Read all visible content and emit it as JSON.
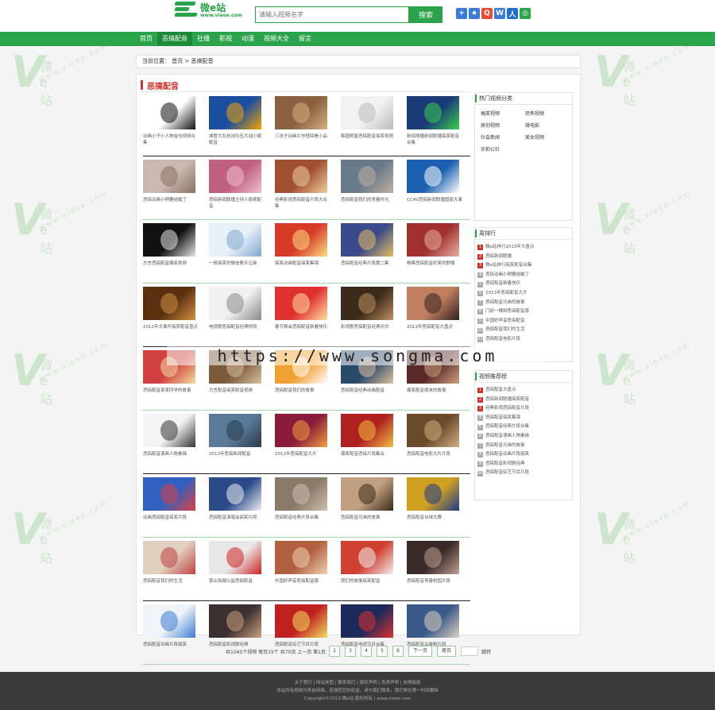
{
  "header": {
    "logo_name": "微e站",
    "logo_url": "www.vieee.com",
    "search_placeholder": "请输入视频名字",
    "search_button": "搜索",
    "share_icons": [
      {
        "name": "plus-icon",
        "glyph": "+",
        "color": "#3a7bd5"
      },
      {
        "name": "star-icon",
        "glyph": "★",
        "color": "#3a7bd5"
      },
      {
        "name": "qzone-icon",
        "glyph": "Q",
        "color": "#e94b35"
      },
      {
        "name": "weibo-icon",
        "glyph": "W",
        "color": "#3a7bd5"
      },
      {
        "name": "renren-icon",
        "glyph": "人",
        "color": "#1f6fc8"
      },
      {
        "name": "wechat-icon",
        "glyph": "◎",
        "color": "#2aa34a"
      }
    ]
  },
  "nav": [
    "首页",
    "恶搞配音",
    "社播",
    "影视",
    "动漫",
    "视频大全",
    "留言"
  ],
  "nav_active": 1,
  "breadcrumb": "当前位置：  首页  >  恶搞配音",
  "section_title": "恶搞配音",
  "videos": [
    {
      "caption": "动画小子小人物金句视频合集",
      "color": "#ffffff",
      "accent": "#111111"
    },
    {
      "caption": "城管大队执法队伍大战小贩配音",
      "color": "#1a4fa0",
      "accent": "#f2a400"
    },
    {
      "caption": "三孩子动画片作怪回看小品",
      "color": "#8a6040",
      "accent": "#d8b080"
    },
    {
      "caption": "韩国明星恶搞配音搞笑视频",
      "color": "#f2f2f2",
      "accent": "#bbbbbb"
    },
    {
      "caption": "新闻胡播新闻联播搞笑配音合集",
      "color": "#1b3a7a",
      "accent": "#3ad04a"
    },
    {
      "caption": "恶搞动画小明要结婚了",
      "color": "#c9b9b0",
      "accent": "#8a7060"
    },
    {
      "caption": "恶搞新闻联播主持人奇葩配音",
      "color": "#c06080",
      "accent": "#f0c0d0"
    },
    {
      "caption": "经典影视恶搞配音片段大合集",
      "color": "#a05030",
      "accent": "#f0d0a0"
    },
    {
      "caption": "恶搞配音我们的青春时光",
      "color": "#6a7a8a",
      "accent": "#c0b0a0"
    },
    {
      "caption": "CCAV恶搞新闻联播国家大事",
      "color": "#1a5fb0",
      "accent": "#ffffff"
    },
    {
      "caption": "方言恶搞配音爆笑视频",
      "color": "#111111",
      "accent": "#e8e8e8"
    },
    {
      "caption": "一段搞笑的微信聊天记录",
      "color": "#e8f0f8",
      "accent": "#7fa8d0"
    },
    {
      "caption": "搞笑动画配音搞笑集锦",
      "color": "#d83a2a",
      "accent": "#f8e080"
    },
    {
      "caption": "恶搞配音经典片段第二集",
      "color": "#3a4a8a",
      "accent": "#e8c060"
    },
    {
      "caption": "杨幂恶搞配音好笑的剧情",
      "color": "#a03030",
      "accent": "#e8b0a0"
    },
    {
      "caption": "2012年大事件搞笑配音盘点",
      "color": "#5a3010",
      "accent": "#d09040"
    },
    {
      "caption": "电视剧恶搞配音经典桥段",
      "color": "#f0f0f0",
      "accent": "#888888"
    },
    {
      "caption": "春节晚会恶搞配音新春快乐",
      "color": "#e03030",
      "accent": "#ffe0a0"
    },
    {
      "caption": "影视剧恶搞配音经典对白",
      "color": "#3a2a1a",
      "accent": "#c09060"
    },
    {
      "caption": "2013年恶搞配音大盘点",
      "color": "#c08060",
      "accent": "#302020"
    },
    {
      "caption": "恶搞配音某某同学的故事",
      "color": "#d04040",
      "accent": "#f0e0a0"
    },
    {
      "caption": "方言配音搞笑配音视频",
      "color": "#7a5a3a",
      "accent": "#d8c0a0"
    },
    {
      "caption": "恶搞配音我们的故事",
      "color": "#f0a030",
      "accent": "#ffffff"
    },
    {
      "caption": "恶搞配音经典动画配音",
      "color": "#2a4a6a",
      "accent": "#e0c0a0"
    },
    {
      "caption": "爆笑配音周末的故事",
      "color": "#5a2a2a",
      "accent": "#d0a080"
    },
    {
      "caption": "恶搞配音漫画人物素描",
      "color": "#f4f4f4",
      "accent": "#333333"
    },
    {
      "caption": "2013年恶搞新闻配音",
      "color": "#5a7a9a",
      "accent": "#2a3a4a"
    },
    {
      "caption": "2013年恶搞配音大片",
      "color": "#8a1a3a",
      "accent": "#f0a040"
    },
    {
      "caption": "爆笑配音恶搞片段集合",
      "color": "#b02020",
      "accent": "#f0c040"
    },
    {
      "caption": "恶搞配音电影大片片段",
      "color": "#6a4a2a",
      "accent": "#d0b080"
    },
    {
      "caption": "动画恶搞配音搞笑片段",
      "color": "#3060c0",
      "accent": "#e04040"
    },
    {
      "caption": "恶搞配音演唱会搞笑片段",
      "color": "#2a4a8a",
      "accent": "#f0f0f0"
    },
    {
      "caption": "恶搞配音经典片段合集",
      "color": "#8a7a6a",
      "accent": "#d0c0b0"
    },
    {
      "caption": "恶搞配音兄弟的故事",
      "color": "#c0a080",
      "accent": "#3a2a1a"
    },
    {
      "caption": "恶搞配音台球大赛",
      "color": "#d0a020",
      "accent": "#1a3a8a"
    },
    {
      "caption": "恶搞配音我们的生活",
      "color": "#e0d0c0",
      "accent": "#c04040"
    },
    {
      "caption": "禁止吸烟公益恶搞配音",
      "color": "#e8e8e8",
      "accent": "#d02020"
    },
    {
      "caption": "中国好声音恶搞配音版",
      "color": "#b06040",
      "accent": "#f0d0b0"
    },
    {
      "caption": "我们的故事搞笑配音",
      "color": "#d04030",
      "accent": "#f0f0f0"
    },
    {
      "caption": "恶搞配音青春校园片段",
      "color": "#3a2a2a",
      "accent": "#c0a090"
    },
    {
      "caption": "恶搞配音动画片段搞笑",
      "color": "#f0f4f8",
      "accent": "#3a7ad0"
    },
    {
      "caption": "恶搞配音影视剧经典",
      "color": "#3a3030",
      "accent": "#d0a080"
    },
    {
      "caption": "恶搞配音综艺节目片段",
      "color": "#c02020",
      "accent": "#f0e060"
    },
    {
      "caption": "恶搞配音电视节目合集",
      "color": "#1a2a5a",
      "accent": "#e03030"
    },
    {
      "caption": "恶搞配音古装剧片段",
      "color": "#3a5a8a",
      "accent": "#e0d0c0"
    }
  ],
  "sidebar": {
    "categories_title": "热门视频分类",
    "categories": [
      "搞笑视频",
      "恐怖视频",
      "原创视频",
      "微电影",
      "社会新闻",
      "美女视频",
      "实拍公社"
    ],
    "weekly_title": "周排行",
    "weekly": [
      "微e站排行2013年大盘点",
      "恶搞新闻联播",
      "微e站排行搞笑配音合集",
      "恶搞动画小明要结婚了",
      "恶搞配音新春快乐",
      "2013年恶搞配音大片",
      "恶搞配音兄弟的故事",
      "门前一棵树恶搞配音版",
      "中国好声音恶搞配音",
      "恶搞配音我们的生活",
      "恶搞配音电影片段"
    ],
    "recommend_title": "视频推荐榜",
    "recommend": [
      "恶搞配音大盘点",
      "恶搞新闻联播搞笑配音",
      "经典影视恶搞配音片段",
      "恶搞配音搞笑集锦",
      "恶搞配音经典片段合集",
      "恶搞配音漫画人物素描",
      "恶搞配音兄弟的故事",
      "恶搞配音动画片段搞笑",
      "恶搞配音影视剧经典",
      "恶搞配音综艺节目片段"
    ]
  },
  "pager": {
    "summary": "共1045个视频 每页15个 共70页 上一页 第1页",
    "pages": [
      "2",
      "3",
      "4",
      "5",
      "6"
    ],
    "next": "下一页",
    "last": "尾页",
    "go": "跳转"
  },
  "footer": {
    "line1": "关于我们 | 网站地图 | 联系我们 | 版权声明 | 免责声明 | 友情链接",
    "line2": "本站所有视频均来自网络，若侵犯您的权益，请与我们联系，我们将在第一时间删除",
    "line3": "Copyright©2013 微e站 版权所有 | www.vieee.com"
  },
  "overlay_text": "https://www.songma.com"
}
